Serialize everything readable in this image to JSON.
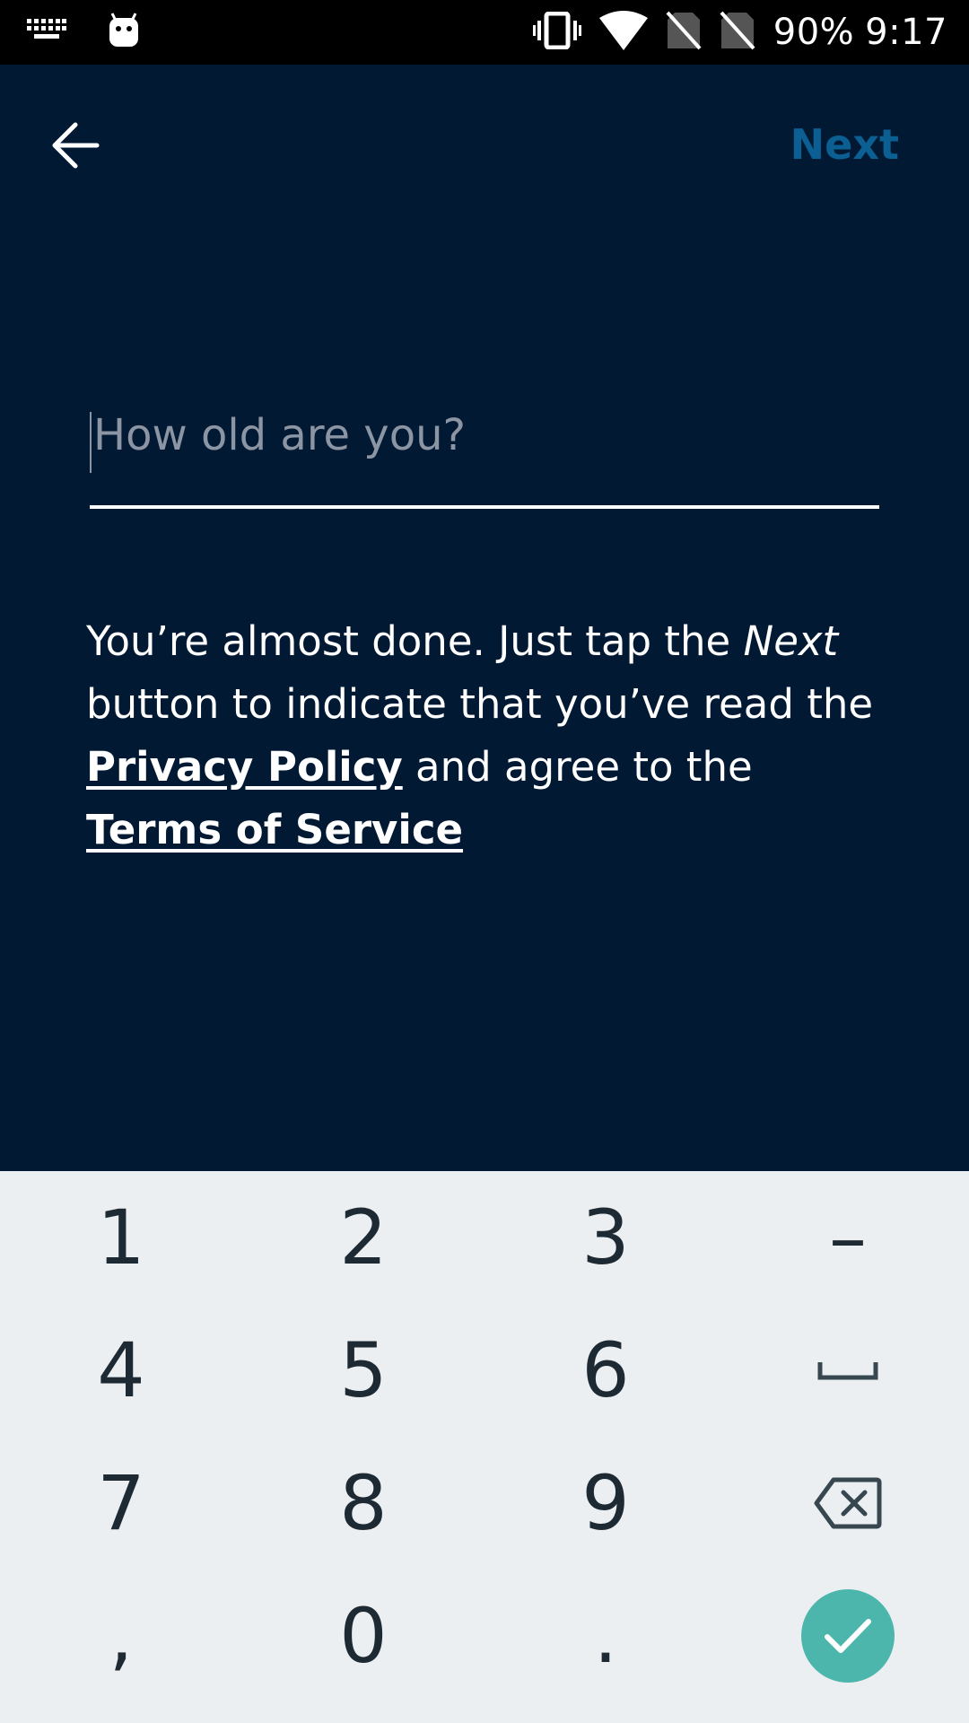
{
  "status_bar": {
    "icons": [
      "keyboard-icon",
      "android-icon",
      "vibrate-icon",
      "wifi-icon",
      "no-sim-icon",
      "no-sim-icon"
    ],
    "battery": "90%",
    "time": "9:17"
  },
  "header": {
    "back_icon": "arrow-left-icon",
    "next_label": "Next"
  },
  "form": {
    "age_placeholder": "How old are you?",
    "age_value": ""
  },
  "info": {
    "part1": "You’re almost done. Just tap the ",
    "next_word": "Next",
    "part2": " button to indicate that you’ve read the ",
    "privacy_link": "Privacy Policy",
    "part3": " and agree to the ",
    "terms_link": "Terms of Service"
  },
  "keyboard": {
    "rows": [
      [
        "1",
        "2",
        "3",
        "–"
      ],
      [
        "4",
        "5",
        "6",
        "space-icon"
      ],
      [
        "7",
        "8",
        "9",
        "backspace-icon"
      ],
      [
        ",",
        "0",
        ".",
        "done-check-icon"
      ]
    ],
    "accent_color": "#4db6ac"
  },
  "colors": {
    "background": "#021934",
    "next_button": "#0b5f93",
    "keyboard_bg": "#eceff2"
  }
}
